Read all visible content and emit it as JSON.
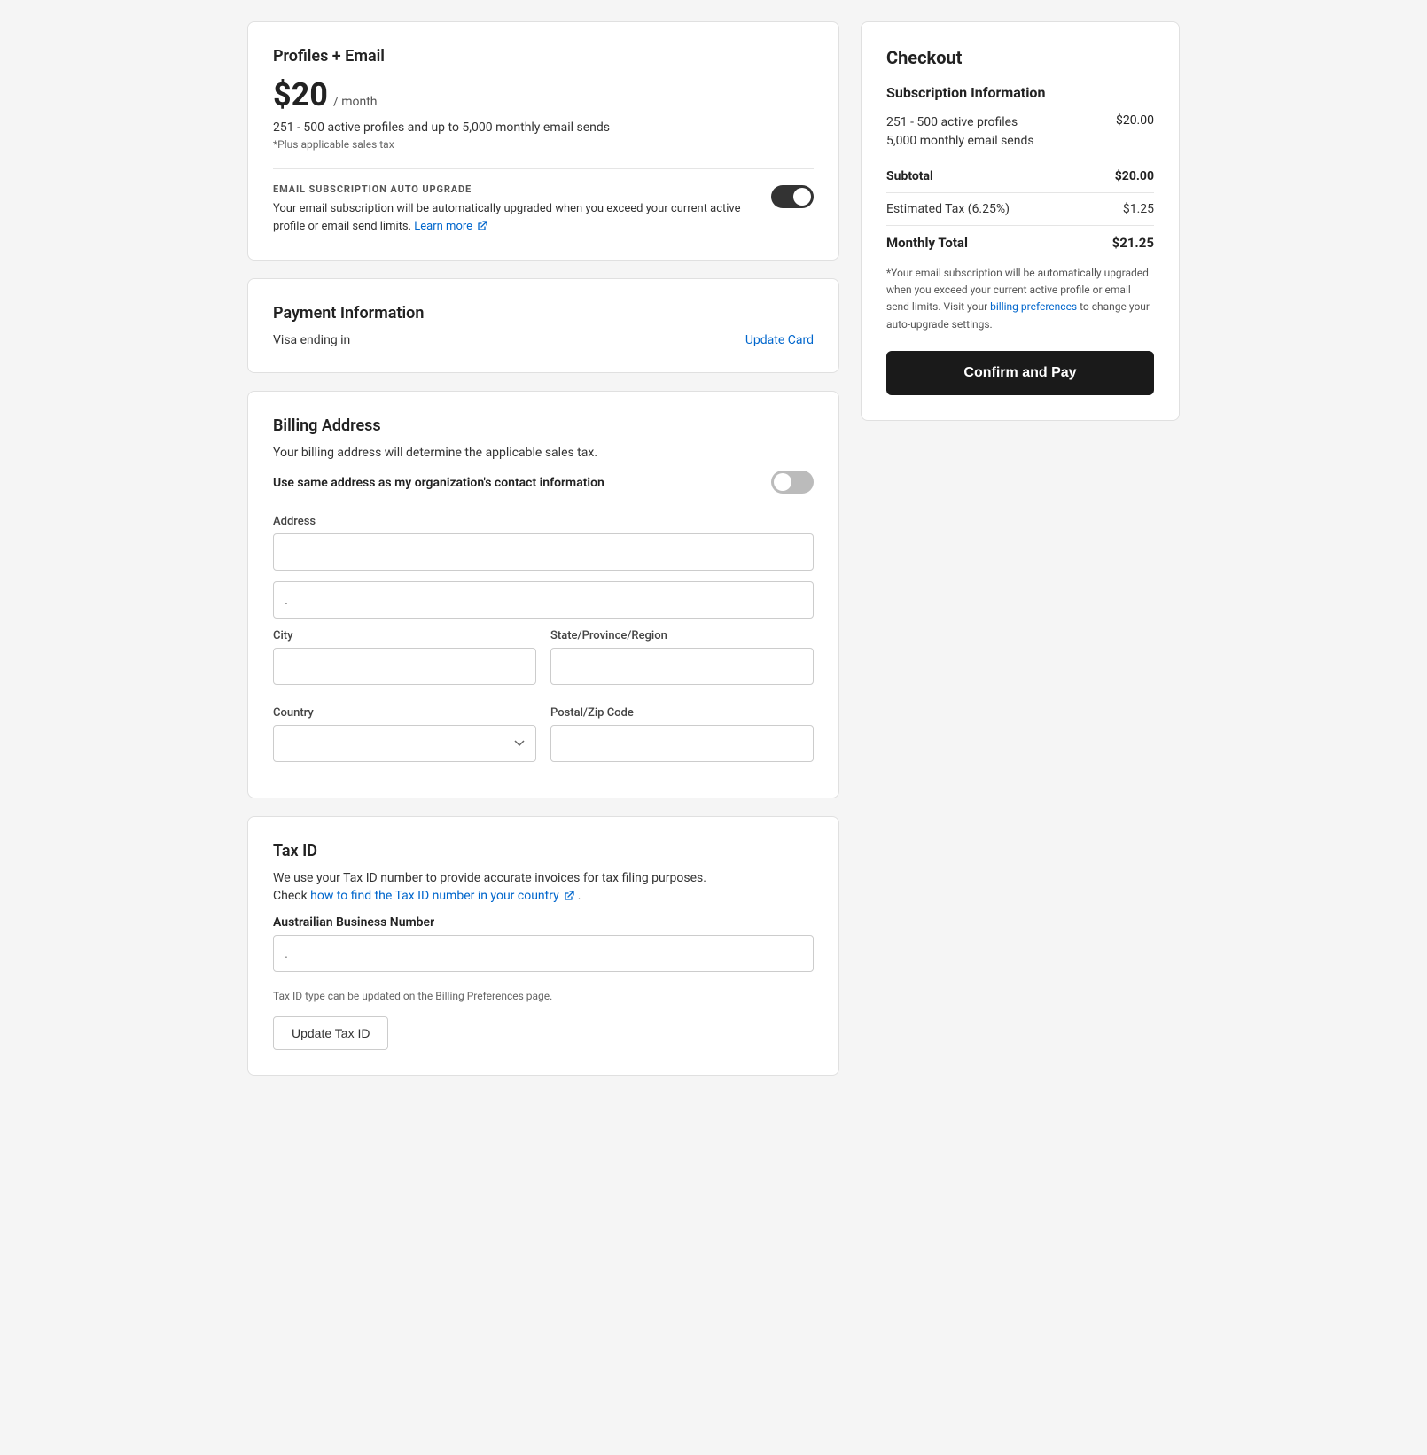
{
  "profiles_card": {
    "title": "Profiles + Email",
    "price": "$20",
    "period": "/ month",
    "description": "251 - 500 active profiles and up to 5,000 monthly email sends",
    "tax_note": "*Plus applicable sales tax",
    "auto_upgrade": {
      "label": "EMAIL SUBSCRIPTION AUTO UPGRADE",
      "description": "Your email subscription will be automatically upgraded when you exceed your current active profile or email send limits.",
      "learn_more_text": "Learn more",
      "toggle_state": "on"
    }
  },
  "payment_card": {
    "title": "Payment Information",
    "visa_label": "Visa ending in",
    "update_link": "Update Card"
  },
  "billing_card": {
    "title": "Billing Address",
    "description": "Your billing address will determine the applicable sales tax.",
    "same_address_label": "Use same address as my organization's contact information",
    "toggle_state": "off",
    "address_label": "Address",
    "address_placeholder": "",
    "address2_placeholder": ".",
    "city_label": "City",
    "city_placeholder": "",
    "state_label": "State/Province/Region",
    "state_placeholder": "",
    "country_label": "Country",
    "country_placeholder": "",
    "postal_label": "Postal/Zip Code",
    "postal_placeholder": ""
  },
  "tax_card": {
    "title": "Tax ID",
    "description": "We use your Tax ID number to provide accurate invoices for tax filing purposes.",
    "check_text": "Check",
    "link_text": "how to find the Tax ID number in your country",
    "field_label": "Austrailian Business Number",
    "field_placeholder": ".",
    "note": "Tax ID type can be updated on the Billing Preferences page.",
    "update_btn": "Update Tax ID"
  },
  "checkout": {
    "title": "Checkout",
    "subscription_label": "Subscription Information",
    "line1": "251 - 500 active profiles",
    "line2": "5,000 monthly email sends",
    "line1_amount": "$20.00",
    "subtotal_label": "Subtotal",
    "subtotal_amount": "$20.00",
    "tax_label": "Estimated Tax (6.25%)",
    "tax_amount": "$1.25",
    "total_label": "Monthly Total",
    "total_amount": "$21.25",
    "note": "*Your email subscription will be automatically upgraded when you exceed your current active profile or email send limits. Visit your",
    "billing_prefs_link": "billing preferences",
    "note_suffix": "to change your auto-upgrade settings.",
    "confirm_btn": "Confirm and Pay"
  }
}
